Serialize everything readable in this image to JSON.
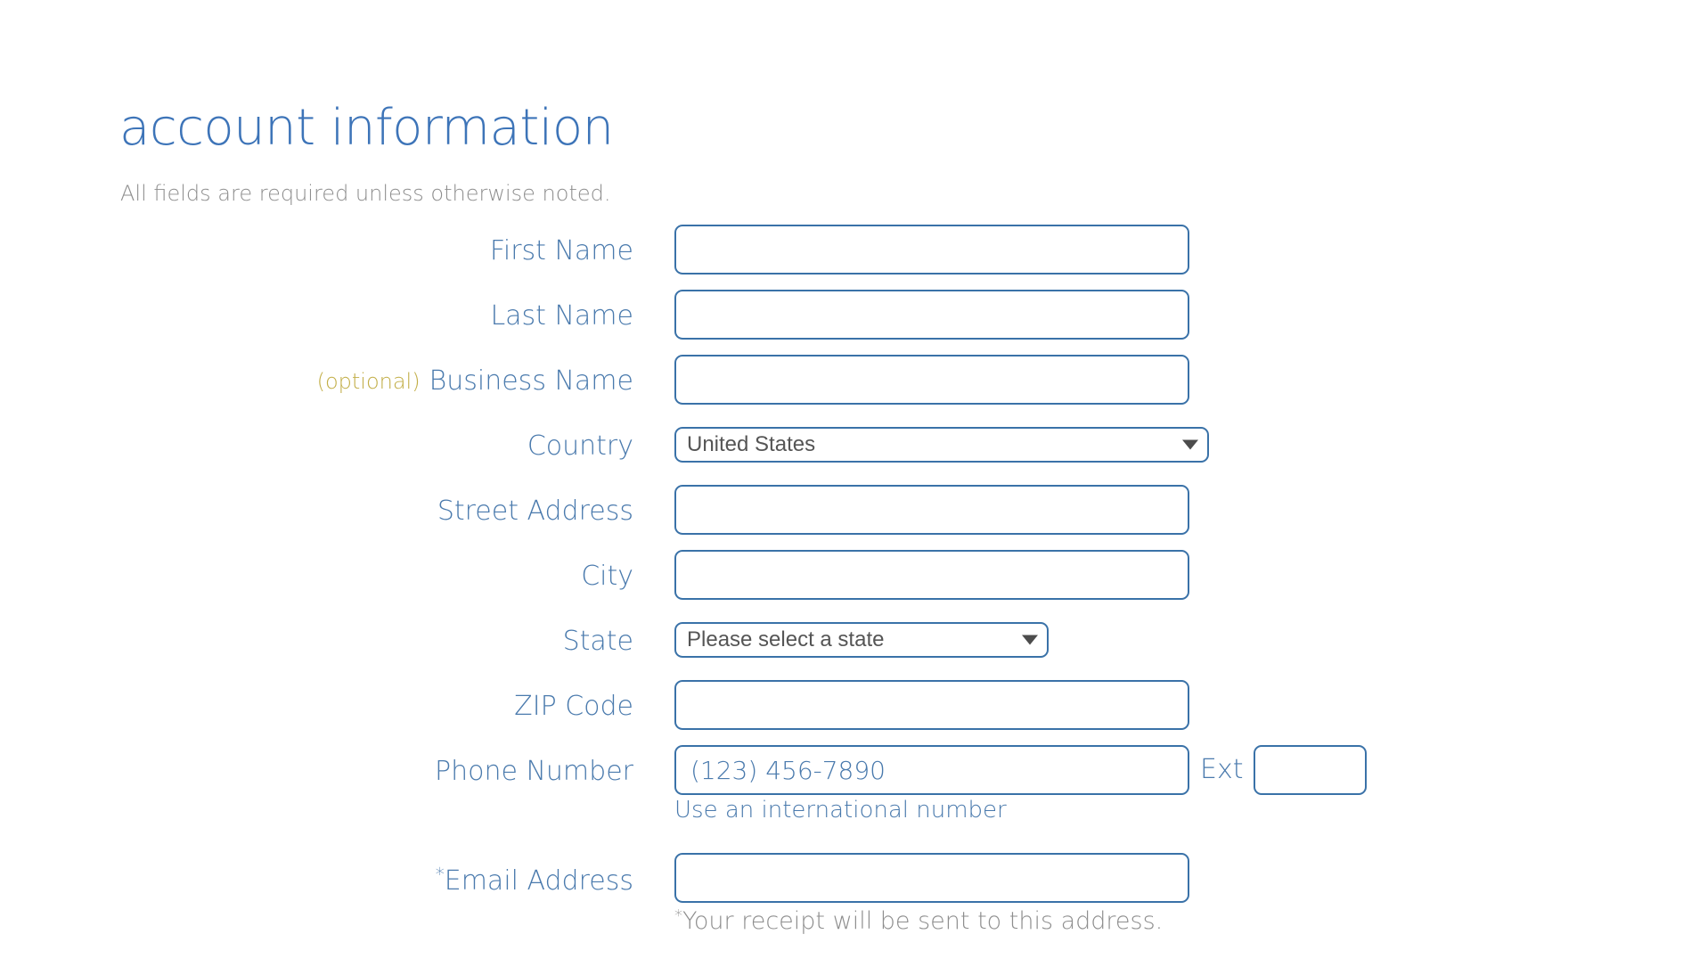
{
  "page": {
    "title": "account information",
    "subtitle": "All fields are required unless otherwise noted.",
    "accent_blue": "#3d74b8",
    "label_blue": "#4a7aad",
    "border_blue": "#3a72a8",
    "optional_gold": "#c2ae47",
    "muted_gray": "#8e8e8e"
  },
  "form": {
    "first_name": {
      "label": "First Name",
      "value": "",
      "placeholder": ""
    },
    "last_name": {
      "label": "Last Name",
      "value": "",
      "placeholder": ""
    },
    "business_name": {
      "optional_tag": "(optional)",
      "label": "Business Name",
      "value": "",
      "placeholder": ""
    },
    "country": {
      "label": "Country",
      "selected": "United States",
      "arrow_icon": "chevron-down-icon"
    },
    "street_address": {
      "label": "Street Address",
      "value": "",
      "placeholder": ""
    },
    "city": {
      "label": "City",
      "value": "",
      "placeholder": ""
    },
    "state": {
      "label": "State",
      "selected": "Please select a state",
      "arrow_icon": "chevron-down-icon"
    },
    "zip_code": {
      "label": "ZIP Code",
      "value": "",
      "placeholder": ""
    },
    "phone": {
      "label": "Phone Number",
      "value": "",
      "placeholder": "(123) 456-7890",
      "ext_label": "Ext",
      "ext_value": "",
      "ext_placeholder": "",
      "helper_link": "Use an international number"
    },
    "email": {
      "star": "*",
      "label": "Email Address",
      "value": "",
      "placeholder": "",
      "note_star": "*",
      "note": "Your receipt will be sent to this address."
    }
  }
}
